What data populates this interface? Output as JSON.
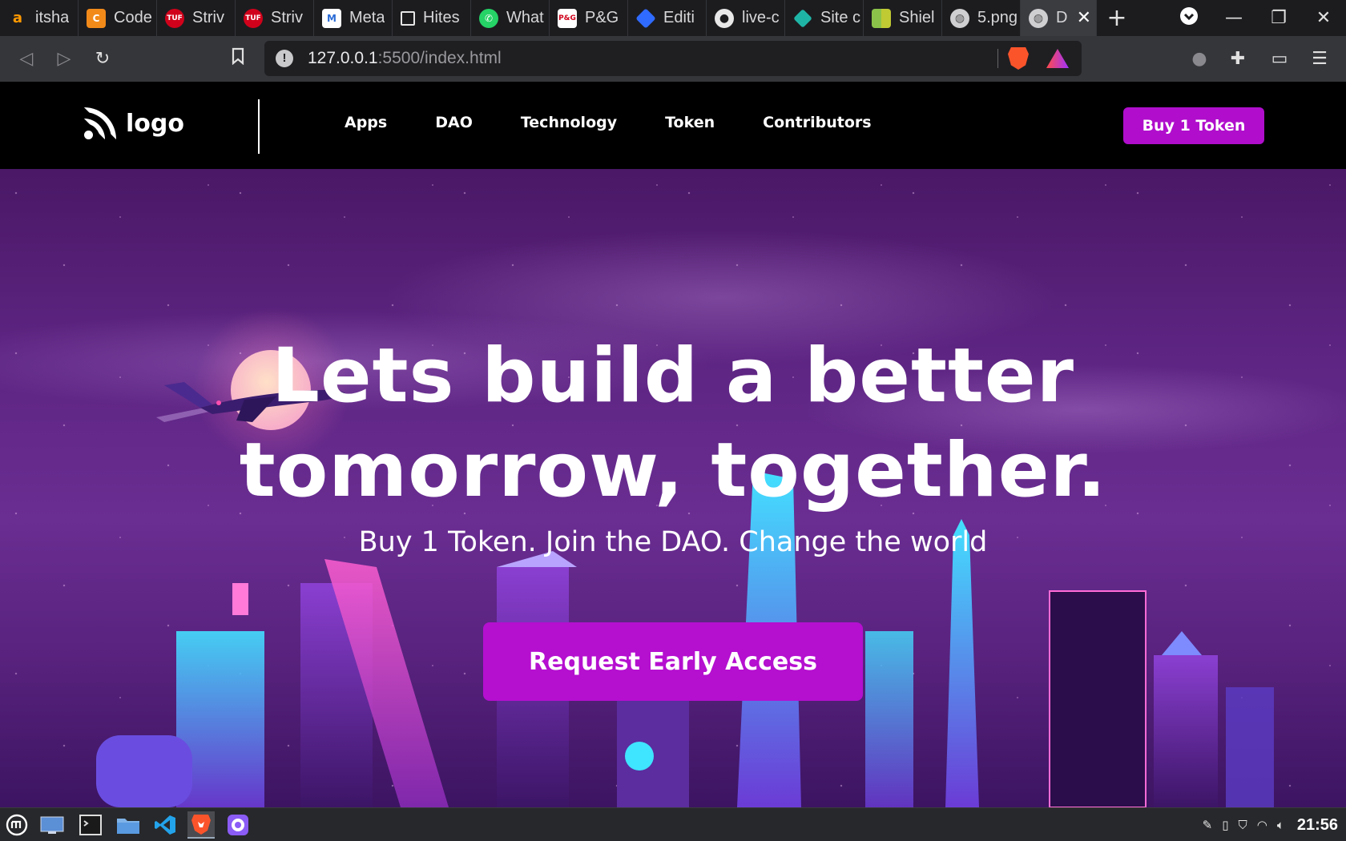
{
  "browser": {
    "tabs": [
      {
        "label": "itsha",
        "icon": "amazon-icon",
        "color": "#1c1c1f"
      },
      {
        "label": "Code",
        "icon": "codeforces-icon",
        "color": "#f28a1a"
      },
      {
        "label": "Striv",
        "icon": "tuf-icon",
        "color": "#d0021b"
      },
      {
        "label": "Striv",
        "icon": "tuf-icon",
        "color": "#d0021b"
      },
      {
        "label": "Meta",
        "icon": "metatags-icon",
        "color": "#ffffff"
      },
      {
        "label": "Hites",
        "icon": "square-icon",
        "color": "#1c1c1f"
      },
      {
        "label": "What",
        "icon": "whatsapp-icon",
        "color": "#25d366"
      },
      {
        "label": "P&G",
        "icon": "pg-icon",
        "color": "#ffffff"
      },
      {
        "label": "Editi",
        "icon": "diamond-icon",
        "color": "#2f6bff"
      },
      {
        "label": "live-c",
        "icon": "github-icon",
        "color": "#1c1c1f"
      },
      {
        "label": "Site c",
        "icon": "netlify-icon",
        "color": "#1fb5a6"
      },
      {
        "label": "Shiel",
        "icon": "shield-icon",
        "color": "#8bc34a"
      },
      {
        "label": "5.png",
        "icon": "globe-icon",
        "color": "#1c1c1f"
      },
      {
        "label": "D",
        "icon": "globe-icon",
        "color": "#3b3c40",
        "active": true
      }
    ],
    "new_tab": "+",
    "address": {
      "host": "127.0.0.1",
      "rest": ":5500/index.html"
    }
  },
  "site": {
    "logo_text": "logo",
    "nav": [
      "Apps",
      "DAO",
      "Technology",
      "Token",
      "Contributors"
    ],
    "buy_button": "Buy 1 Token",
    "hero_title_line1": "Lets build a better",
    "hero_title_line2": "tomorrow, together.",
    "hero_subtitle": "Buy 1 Token. Join the DAO. Change the world",
    "cta": "Request Early Access",
    "colors": {
      "accent": "#b00ecc",
      "cta": "#b50fd0"
    }
  },
  "taskbar": {
    "apps": [
      "mint-menu-icon",
      "show-desktop-icon",
      "terminal-icon",
      "files-icon",
      "vscode-icon",
      "brave-icon",
      "github-desktop-icon"
    ],
    "clock": "21:56"
  }
}
